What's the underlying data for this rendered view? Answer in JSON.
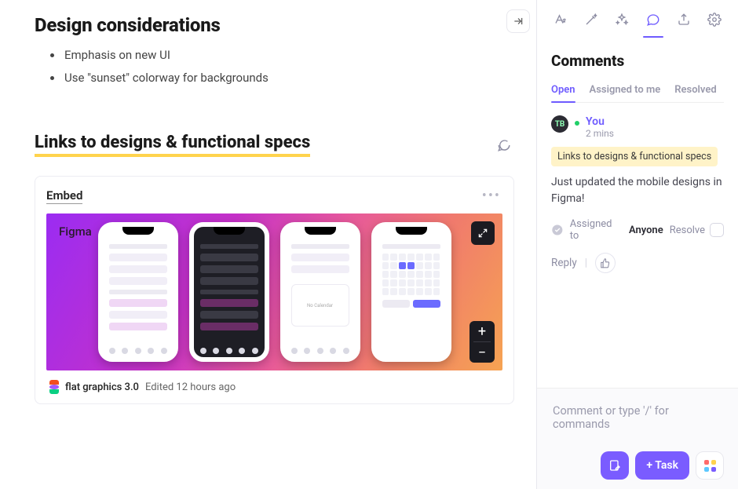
{
  "main": {
    "heading1": "Design considerations",
    "bullets": [
      "Emphasis on new UI",
      "Use \"sunset\" colorway for backgrounds"
    ],
    "heading2": "Links to designs & functional specs",
    "embed": {
      "label": "Embed",
      "provider": "Figma",
      "file_name": "flat graphics 3.0",
      "edited_label": "Edited 12 hours ago",
      "expand_icon": "expand-icon",
      "zoom_in_icon": "plus-icon",
      "zoom_out_icon": "minus-icon"
    }
  },
  "toolbar": {
    "collapse_icon": "collapse-right-icon",
    "tools": [
      "text-style",
      "ai-assist",
      "sparkles",
      "comments",
      "share",
      "settings"
    ],
    "active_tool": "comments"
  },
  "sidebar": {
    "title": "Comments",
    "tabs": {
      "open": "Open",
      "assigned": "Assigned to me",
      "resolved": "Resolved",
      "active": "open"
    },
    "comment": {
      "avatar_initials": "TB",
      "author": "You",
      "time": "2 mins",
      "reference": "Links to designs & functional specs",
      "body": "Just updated the mobile designs in Figma!",
      "assigned_label": "Assigned to",
      "assigned_to": "Anyone",
      "resolve_label": "Resolve",
      "reply_label": "Reply"
    },
    "composer": {
      "placeholder": "Comment or type '/' for commands",
      "task_button": "+  Task"
    }
  }
}
